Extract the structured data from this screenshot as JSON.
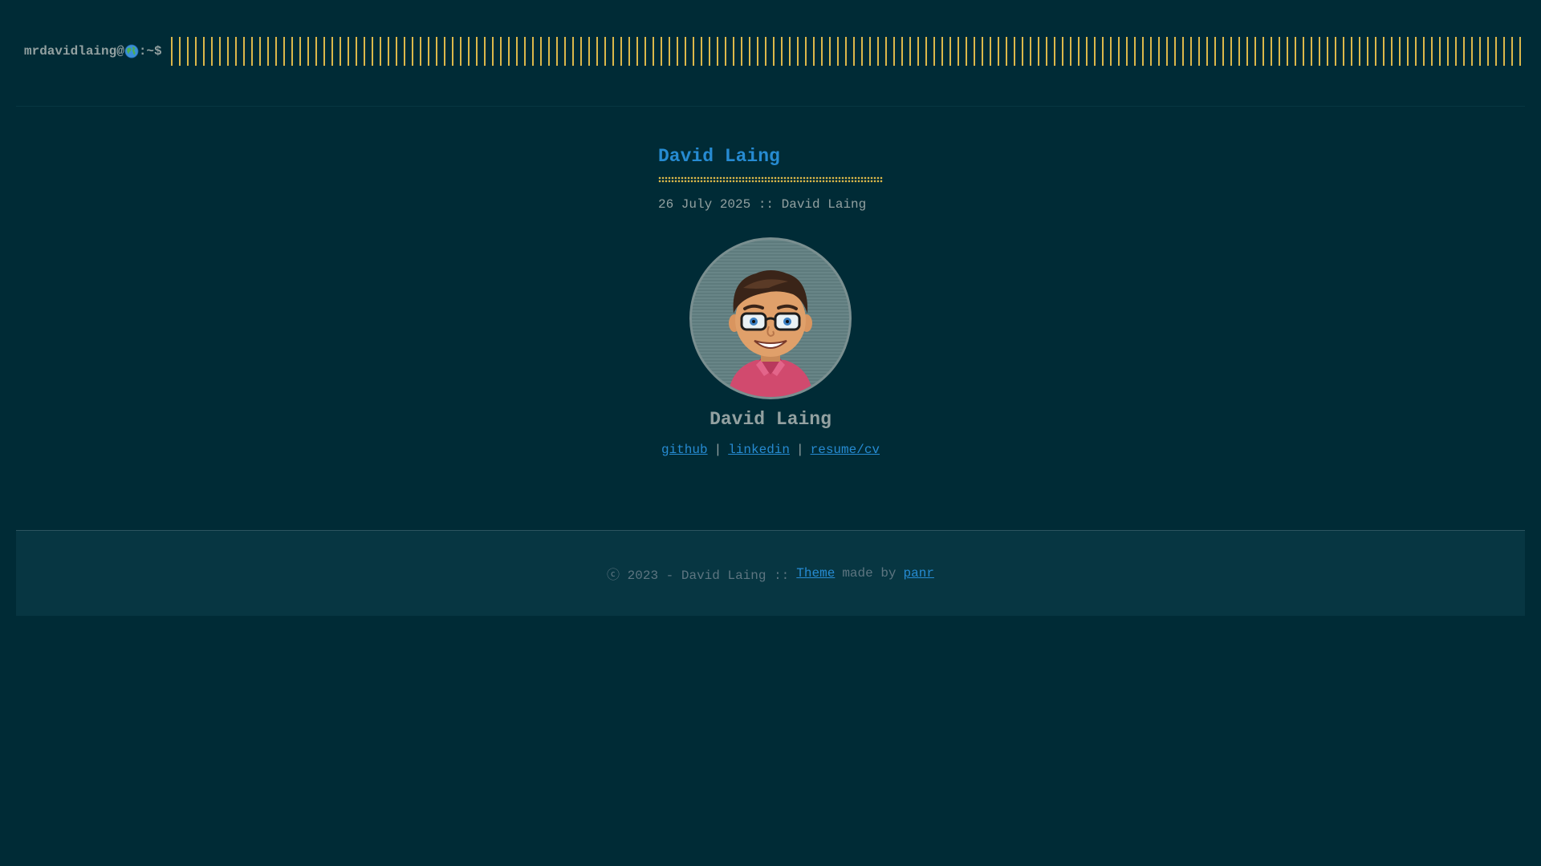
{
  "header": {
    "logo_prefix": "mrdavidlaing@",
    "logo_suffix": ":~$",
    "globe_icon": "globe-icon"
  },
  "post": {
    "title": "David Laing",
    "meta": "26 July 2025 :: David Laing"
  },
  "profile": {
    "name": "David Laing",
    "avatar_icon": "bitmoji-avatar",
    "links": [
      {
        "label": "github"
      },
      {
        "label": "linkedin"
      },
      {
        "label": "resume/cv"
      }
    ],
    "separator": "|"
  },
  "footer": {
    "copyright": "ⓒ 2023 - David Laing ::",
    "theme_link": "Theme",
    "made_by": "made by",
    "author_link": "panr"
  },
  "colors": {
    "background": "#002b36",
    "footer_bg": "#073642",
    "link": "#268bd2",
    "accent": "#dcb84a",
    "text": "#93a1a1"
  }
}
